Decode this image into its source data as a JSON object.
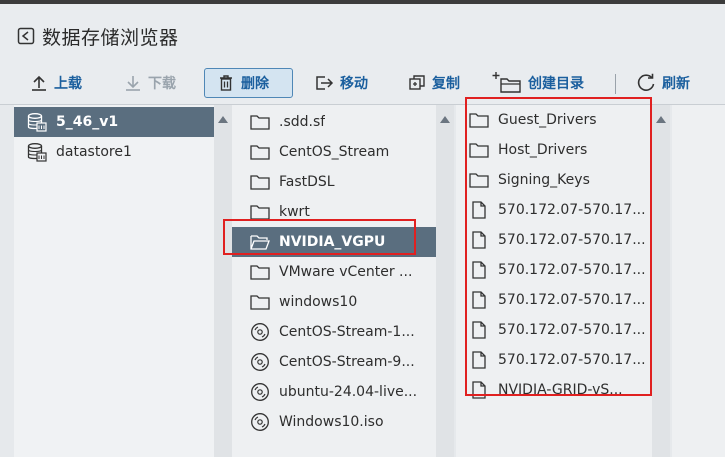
{
  "window": {
    "title": "数据存储浏览器"
  },
  "toolbar": {
    "upload": "上载",
    "download": "下载",
    "delete": "删除",
    "move": "移动",
    "copy": "复制",
    "create_dir": "创建目录",
    "refresh": "刷新"
  },
  "datastores": [
    "5_46_v1",
    "datastore1"
  ],
  "folder_list": [
    ".sdd.sf",
    "CentOS_Stream",
    "FastDSL",
    "kwrt",
    "NVIDIA_VGPU",
    "VMware vCenter ...",
    "windows10",
    "CentOS-Stream-1...",
    "CentOS-Stream-9...",
    "ubuntu-24.04-live...",
    "Windows10.iso"
  ],
  "contents": [
    "Guest_Drivers",
    "Host_Drivers",
    "Signing_Keys",
    "570.172.07-570.17...",
    "570.172.07-570.17...",
    "570.172.07-570.17...",
    "570.172.07-570.17...",
    "570.172.07-570.17...",
    "570.172.07-570.17...",
    "NVIDIA-GRID-vS..."
  ],
  "colors": {
    "accent": "#1b5f9e",
    "selection": "#5a6e7f",
    "highlight_box": "#e02020"
  }
}
